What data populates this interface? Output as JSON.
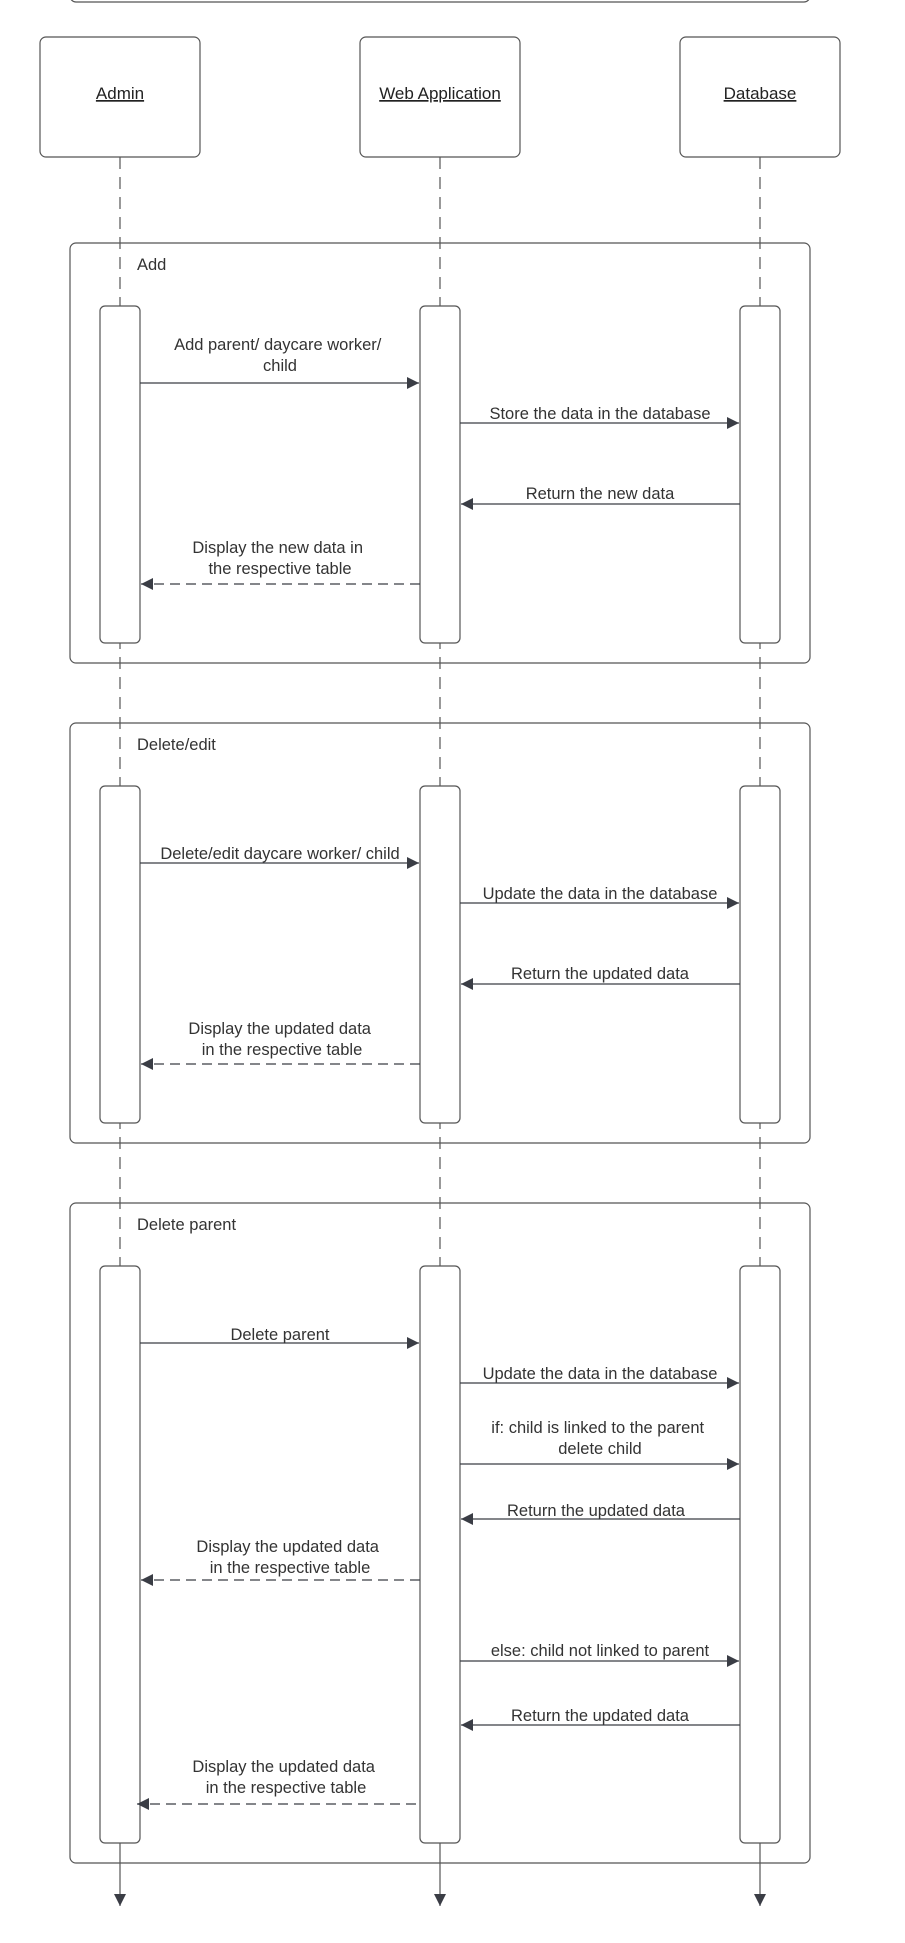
{
  "actors": [
    {
      "id": "admin",
      "label": "Admin"
    },
    {
      "id": "web",
      "label": "Web Application"
    },
    {
      "id": "db",
      "label": "Database"
    }
  ],
  "fragments": [
    {
      "label": "Add",
      "messages": [
        {
          "from": "admin",
          "to": "web",
          "style": "solid",
          "lines": [
            "Add parent/ daycare worker/",
            "child"
          ]
        },
        {
          "from": "web",
          "to": "db",
          "style": "solid",
          "lines": [
            "Store the data in the database"
          ]
        },
        {
          "from": "db",
          "to": "web",
          "style": "solid",
          "lines": [
            "Return the new data"
          ]
        },
        {
          "from": "web",
          "to": "admin",
          "style": "dashed",
          "lines": [
            "Display the new data in",
            "the respective table"
          ]
        }
      ]
    },
    {
      "label": "Delete/edit",
      "messages": [
        {
          "from": "admin",
          "to": "web",
          "style": "solid",
          "lines": [
            "Delete/edit daycare worker/ child"
          ]
        },
        {
          "from": "web",
          "to": "db",
          "style": "solid",
          "lines": [
            "Update the data in the database"
          ]
        },
        {
          "from": "db",
          "to": "web",
          "style": "solid",
          "lines": [
            "Return the updated data"
          ]
        },
        {
          "from": "web",
          "to": "admin",
          "style": "dashed",
          "lines": [
            "Display the updated data",
            "in the respective table"
          ]
        }
      ]
    },
    {
      "label": "Delete parent",
      "messages": [
        {
          "from": "admin",
          "to": "web",
          "style": "solid",
          "lines": [
            "Delete parent"
          ]
        },
        {
          "from": "web",
          "to": "db",
          "style": "solid",
          "lines": [
            "Update the data in the database"
          ]
        },
        {
          "from": "web",
          "to": "db",
          "style": "solid",
          "lines": [
            "if: child is linked to the parent",
            "delete child"
          ]
        },
        {
          "from": "db",
          "to": "web",
          "style": "solid",
          "lines": [
            "Return the updated data"
          ]
        },
        {
          "from": "web",
          "to": "admin",
          "style": "dashed",
          "lines": [
            "Display the updated data",
            "in the respective table"
          ]
        },
        {
          "from": "web",
          "to": "db",
          "style": "solid",
          "lines": [
            "else: child not linked to parent"
          ]
        },
        {
          "from": "db",
          "to": "web",
          "style": "solid",
          "lines": [
            "Return the updated data"
          ]
        },
        {
          "from": "web",
          "to": "admin",
          "style": "dashed",
          "lines": [
            "Display the updated data",
            "in the respective table"
          ]
        }
      ]
    }
  ]
}
